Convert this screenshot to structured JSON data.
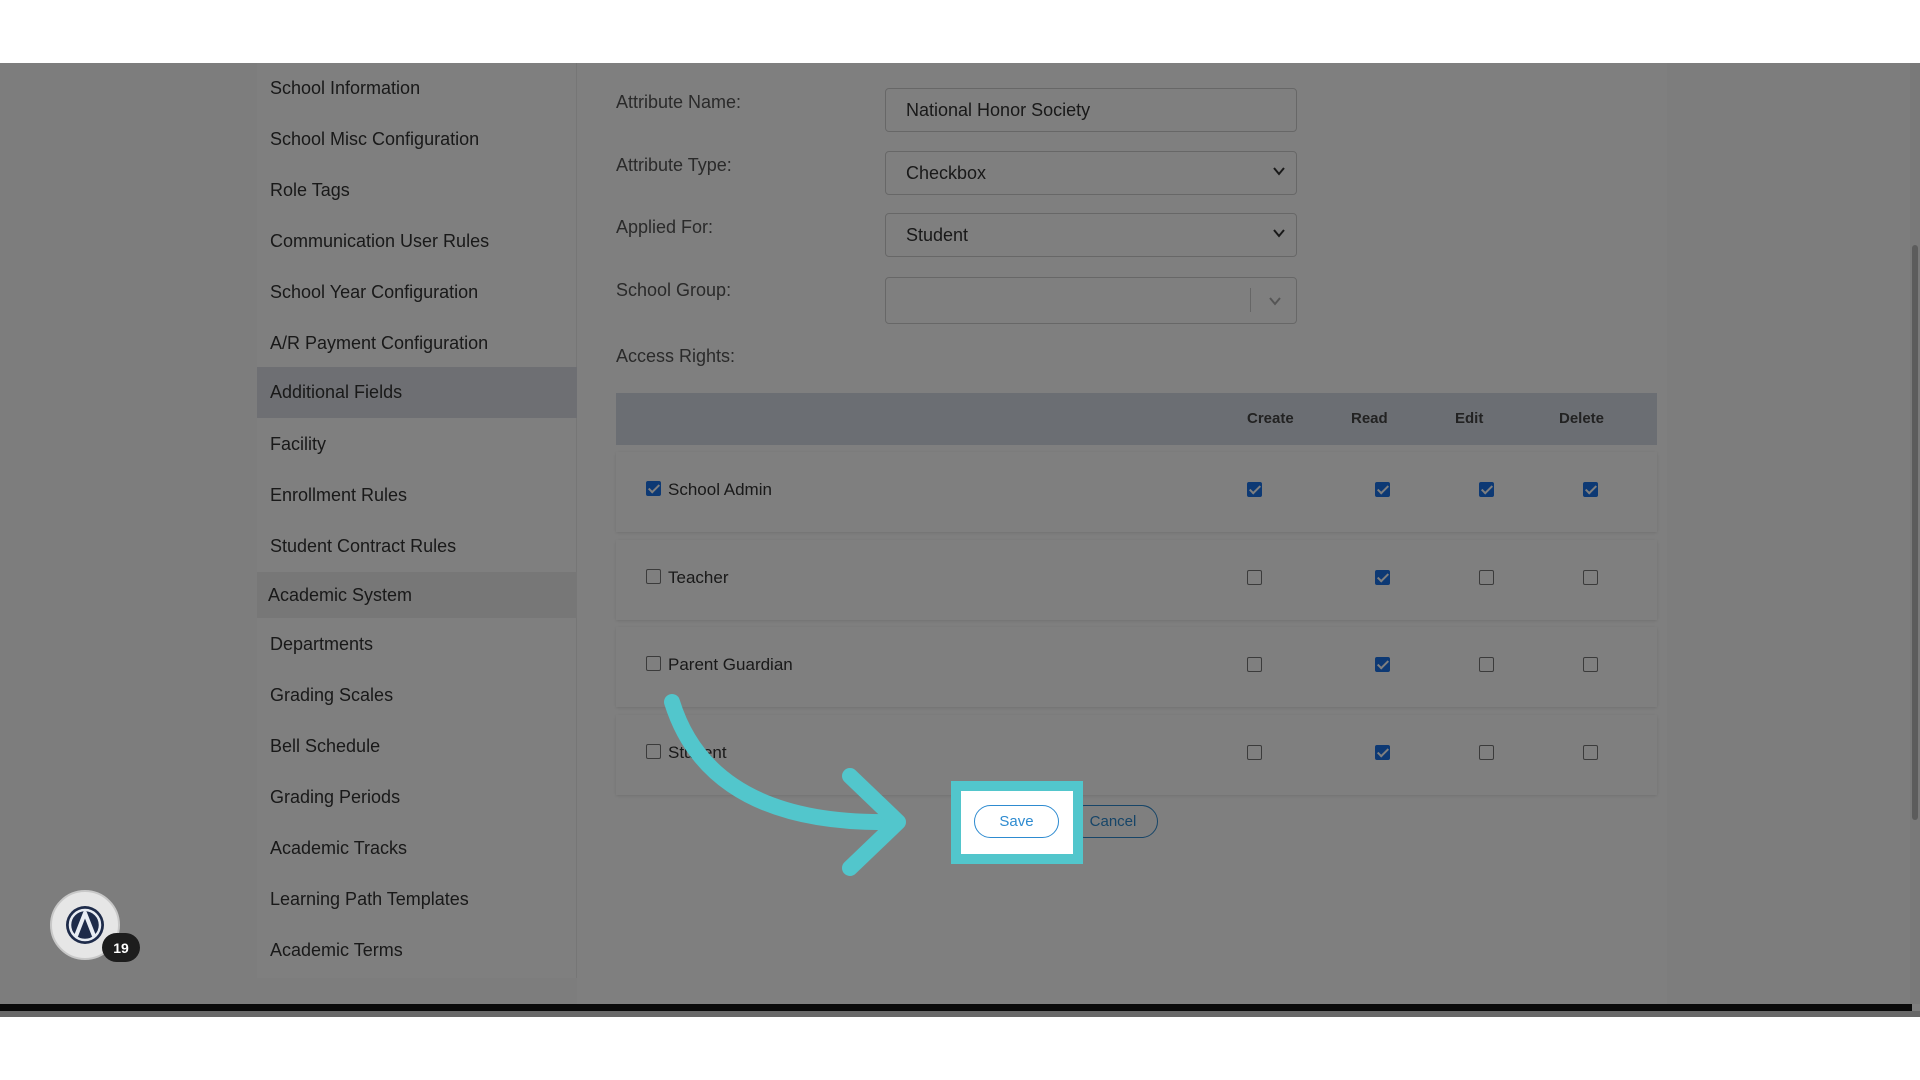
{
  "sidebar": {
    "items": [
      {
        "label": "School Information"
      },
      {
        "label": "School Misc Configuration"
      },
      {
        "label": "Role Tags"
      },
      {
        "label": "Communication User Rules"
      },
      {
        "label": "School Year Configuration"
      },
      {
        "label": "A/R Payment Configuration"
      },
      {
        "label": "Additional Fields",
        "active": true
      },
      {
        "label": "Facility"
      },
      {
        "label": "Enrollment Rules"
      },
      {
        "label": "Student Contract Rules"
      },
      {
        "label": "Academic System",
        "section": true
      },
      {
        "label": "Departments"
      },
      {
        "label": "Grading Scales"
      },
      {
        "label": "Bell Schedule"
      },
      {
        "label": "Grading Periods"
      },
      {
        "label": "Academic Tracks"
      },
      {
        "label": "Learning Path Templates"
      },
      {
        "label": "Academic Terms"
      }
    ]
  },
  "form": {
    "attribute_name_label": "Attribute Name:",
    "attribute_name_value": "National Honor Society",
    "attribute_type_label": "Attribute Type:",
    "attribute_type_value": "Checkbox",
    "applied_for_label": "Applied For:",
    "applied_for_value": "Student",
    "school_group_label": "School Group:",
    "school_group_value": "",
    "access_rights_label": "Access Rights:"
  },
  "access_table": {
    "headers": [
      "Create",
      "Read",
      "Edit",
      "Delete"
    ],
    "rows": [
      {
        "label": "School Admin",
        "row_checked": true,
        "create": true,
        "read": true,
        "edit": true,
        "delete": true
      },
      {
        "label": "Teacher",
        "row_checked": false,
        "create": false,
        "read": true,
        "edit": false,
        "delete": false
      },
      {
        "label": "Parent Guardian",
        "row_checked": false,
        "create": false,
        "read": true,
        "edit": false,
        "delete": false
      },
      {
        "label": "Student",
        "row_checked": false,
        "create": false,
        "read": true,
        "edit": false,
        "delete": false
      }
    ]
  },
  "actions": {
    "save_label": "Save",
    "cancel_label": "Cancel"
  },
  "widget": {
    "badge_count": "19"
  },
  "colors": {
    "accent": "#2e8bd0",
    "highlight": "#52c6cc",
    "checkbox_on": "#1a73e8"
  }
}
